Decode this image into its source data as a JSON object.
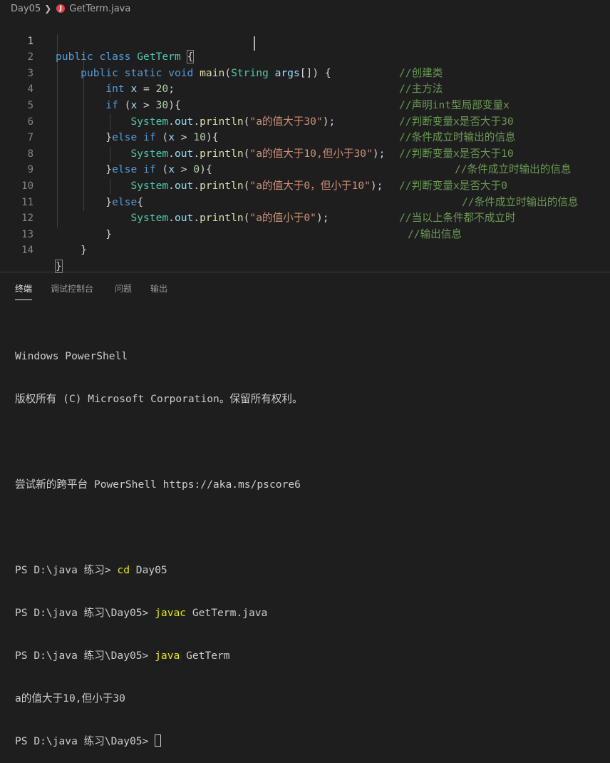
{
  "breadcrumb": {
    "folder": "Day05",
    "file": "GetTerm.java",
    "file_icon": "java-icon"
  },
  "editor": {
    "line_numbers": [
      "1",
      "2",
      "3",
      "4",
      "5",
      "6",
      "7",
      "8",
      "9",
      "10",
      "11",
      "12",
      "13",
      "14"
    ],
    "active_line": "1",
    "lines": [
      {
        "t1": "public",
        "t2": "class",
        "t3": "GetTerm",
        "t4": "{",
        "comment": "//创建类"
      },
      {
        "t1": "public",
        "t2": "static",
        "t3": "void",
        "t4": "main",
        "t5": "(",
        "t6": "String",
        "t7": "args",
        "t8": "[]) {",
        "comment": "//主方法"
      },
      {
        "t1": "int",
        "t2": "x",
        "t3": " = ",
        "t4": "20",
        "t5": ";",
        "comment": "//声明int型局部变量x"
      },
      {
        "t1": "if",
        "t2": " (",
        "t3": "x",
        "t4": " > ",
        "t5": "30",
        "t6": "){",
        "comment": "//判断变量x是否大于30"
      },
      {
        "t1": "System",
        "t2": ".",
        "t3": "out",
        "t4": ".",
        "t5": "println",
        "t6": "(",
        "t7": "\"a的值大于30\"",
        "t8": ");",
        "comment": "//条件成立时输出的信息"
      },
      {
        "t1": "}",
        "t2": "else",
        "t3": " ",
        "t4": "if",
        "t5": " (",
        "t6": "x",
        "t7": " > ",
        "t8": "10",
        "t9": "){",
        "comment": "//判断变量x是否大于10"
      },
      {
        "t1": "System",
        "t2": ".",
        "t3": "out",
        "t4": ".",
        "t5": "println",
        "t6": "(",
        "t7": "\"a的值大于10,但小于30\"",
        "t8": ");",
        "comment": "//条件成立时输出的信息"
      },
      {
        "t1": "}",
        "t2": "else",
        "t3": " ",
        "t4": "if",
        "t5": " (",
        "t6": "x",
        "t7": " > ",
        "t8": "0",
        "t9": "){",
        "comment": "//判断变量x是否大于0"
      },
      {
        "t1": "System",
        "t2": ".",
        "t3": "out",
        "t4": ".",
        "t5": "println",
        "t6": "(",
        "t7": "\"a的值大于0，但小于10\"",
        "t8": ");",
        "comment": "//条件成立时输出的信息"
      },
      {
        "t1": "}",
        "t2": "else",
        "t3": "{",
        "comment": "//当以上条件都不成立时"
      },
      {
        "t1": "System",
        "t2": ".",
        "t3": "out",
        "t4": ".",
        "t5": "println",
        "t6": "(",
        "t7": "\"a的值小于0\"",
        "t8": ");",
        "comment": "//输出信息"
      },
      {
        "t1": "}"
      },
      {
        "t1": "}"
      },
      {
        "t1": "}"
      }
    ]
  },
  "panel": {
    "tabs": [
      "终端",
      "调试控制台",
      "问题",
      "输出"
    ],
    "active_tab": "终端"
  },
  "terminal": {
    "line1": "Windows PowerShell",
    "line2": "版权所有 (C) Microsoft Corporation。保留所有权利。",
    "line3": "尝试新的跨平台 PowerShell https://aka.ms/pscore6",
    "prompt1": "PS D:\\java 练习> ",
    "cmd1a": "cd",
    "cmd1b": " Day05",
    "prompt2": "PS D:\\java 练习\\Day05> ",
    "cmd2a": "javac",
    "cmd2b": " GetTerm.java",
    "prompt3": "PS D:\\java 练习\\Day05> ",
    "cmd3a": "java",
    "cmd3b": " GetTerm",
    "output": "a的值大于10,但小于30",
    "prompt4": "PS D:\\java 练习\\Day05> "
  }
}
